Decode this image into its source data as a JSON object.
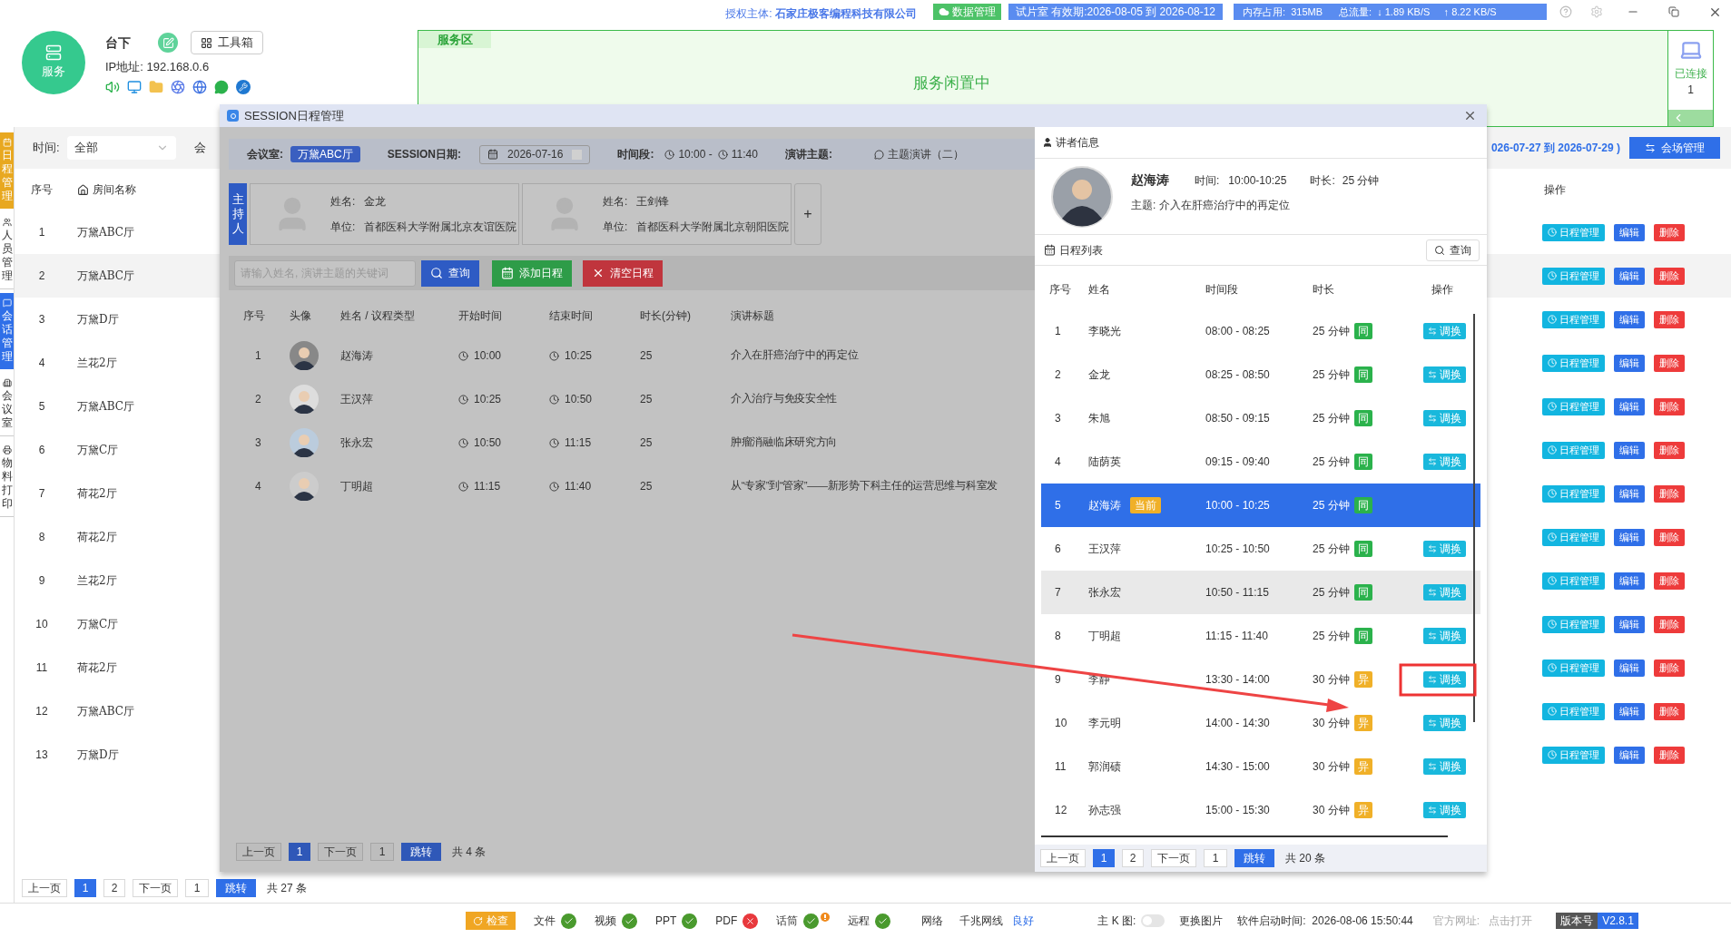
{
  "header": {
    "badge": "服务",
    "name": "台下",
    "toolbox": "工具箱",
    "ip": "IP地址: 192.168.0.6",
    "license_label": "授权主体:",
    "license": "石家庄极客编程科技有限公司",
    "data_button": "数据管理",
    "trial": "试片室  有效期:2026-08-05 到 2026-08-12",
    "memory": "内存占用:  315MB",
    "traffic": "总流量:  ↓ 1.89 KB/S     ↑ 8.22 KB/S"
  },
  "service_area": {
    "label": "服务区",
    "status": "服务闲置中",
    "connected_label": "已连接",
    "connected_count": "1"
  },
  "sidebar": {
    "tabs": [
      {
        "label": "日程管理",
        "color": "#e8a820"
      },
      {
        "label": "人员管理",
        "color": "#ffffff"
      },
      {
        "label": "会话管理",
        "color": "#2f6fe8"
      },
      {
        "label": "会议室",
        "color": "#ffffff"
      },
      {
        "label": "物料打印",
        "color": "#ffffff"
      }
    ]
  },
  "filter": {
    "label": "时间:",
    "value": "全部",
    "next_label": "会",
    "date_range": "026-07-27 到 2026-07-29 )",
    "venue_button": "会场管理"
  },
  "table": {
    "columns": [
      "序号",
      "房间名称",
      "操作"
    ],
    "rows": [
      {
        "index": "1",
        "room": "万黛ABC厅",
        "highlighted": false,
        "actions": [
          "日程管理",
          "编辑",
          "删除"
        ]
      },
      {
        "index": "2",
        "room": "万黛ABC厅",
        "highlighted": true,
        "actions": [
          "日程管理",
          "编辑",
          "删除"
        ]
      },
      {
        "index": "3",
        "room": "万黛D厅",
        "highlighted": false,
        "actions": [
          "日程管理",
          "编辑",
          "删除"
        ]
      },
      {
        "index": "4",
        "room": "兰花2厅",
        "highlighted": false,
        "actions": [
          "日程管理",
          "编辑",
          "删除"
        ]
      },
      {
        "index": "5",
        "room": "万黛ABC厅",
        "highlighted": false,
        "actions": [
          "日程管理",
          "编辑",
          "删除"
        ]
      },
      {
        "index": "6",
        "room": "万黛C厅",
        "highlighted": false,
        "actions": [
          "日程管理",
          "编辑",
          "删除"
        ]
      },
      {
        "index": "7",
        "room": "荷花2厅",
        "highlighted": false,
        "actions": [
          "日程管理",
          "编辑",
          "删除"
        ]
      },
      {
        "index": "8",
        "room": "荷花2厅",
        "highlighted": false,
        "actions": [
          "日程管理",
          "编辑",
          "删除"
        ]
      },
      {
        "index": "9",
        "room": "兰花2厅",
        "highlighted": false,
        "actions": [
          "日程管理",
          "编辑",
          "删除"
        ]
      },
      {
        "index": "10",
        "room": "万黛C厅",
        "highlighted": false,
        "actions": [
          "日程管理",
          "编辑",
          "删除"
        ]
      },
      {
        "index": "11",
        "room": "荷花2厅",
        "highlighted": false,
        "actions": [
          "日程管理",
          "编辑",
          "删除"
        ]
      },
      {
        "index": "12",
        "room": "万黛ABC厅",
        "highlighted": false,
        "actions": [
          "日程管理",
          "编辑",
          "删除"
        ]
      },
      {
        "index": "13",
        "room": "万黛D厅",
        "highlighted": false,
        "actions": [
          "日程管理",
          "编辑",
          "删除"
        ]
      }
    ]
  },
  "pagination": {
    "prev": "上一页",
    "pages": [
      {
        "label": "1",
        "selected": true
      },
      {
        "label": "2",
        "selected": false
      }
    ],
    "next": "下一页",
    "page_input": "1",
    "jump": "跳转",
    "total": "共 27 条"
  },
  "status_bar": {
    "check": "检查",
    "items": [
      {
        "label": "文件",
        "ok": true,
        "warning": false
      },
      {
        "label": "视频",
        "ok": true,
        "warning": false
      },
      {
        "label": "PPT",
        "ok": true,
        "warning": false
      },
      {
        "label": "PDF",
        "ok": false,
        "warning": false
      },
      {
        "label": "话筒",
        "ok": true,
        "warning": true
      },
      {
        "label": "远程",
        "ok": true,
        "warning": false
      }
    ],
    "network_label": "网络",
    "network_type": "千兆网线",
    "network_quality": "良好",
    "k_label": "主 K 图:",
    "k_on": false,
    "change_image": "更换图片",
    "start_time": "软件启动时间:  2026-08-06 15:50:44",
    "website_label": "官方网址:",
    "website_link": "点击打开",
    "version_label": "版本号",
    "version": "V2.8.1"
  },
  "dialog": {
    "title": "SESSION日程管理",
    "filters": {
      "room_label": "会议室:",
      "room": "万黛ABC厅",
      "date_label": "SESSION日期:",
      "date": "2026-07-16",
      "time_label": "时间段:",
      "start": "10:00 -",
      "end": "11:40",
      "topic_label": "演讲主题:",
      "topic": "主题演讲（二）"
    },
    "hosts_label": "主持人",
    "hosts": [
      {
        "name_label": "姓名:",
        "name": "金龙",
        "org_label": "单位:",
        "org": "首都医科大学附属北京友谊医院"
      },
      {
        "name_label": "姓名:",
        "name": "王剑锋",
        "org_label": "单位:",
        "org": "首都医科大学附属北京朝阳医院"
      }
    ],
    "add_host": "+",
    "search": {
      "placeholder": "请输入姓名, 演讲主题的关键词",
      "query": "查询",
      "add": "添加日程",
      "clear": "清空日程"
    },
    "table": {
      "columns": [
        "序号",
        "头像",
        "姓名 / 议程类型",
        "开始时间",
        "结束时间",
        "时长(分钟)",
        "演讲标题"
      ],
      "rows": [
        {
          "index": "1",
          "name": "赵海涛",
          "start": "10:00",
          "end": "10:25",
          "duration": "25",
          "title": "介入在肝癌治疗中的再定位"
        },
        {
          "index": "2",
          "name": "王汉萍",
          "start": "10:25",
          "end": "10:50",
          "duration": "25",
          "title": "介入治疗与免疫安全性"
        },
        {
          "index": "3",
          "name": "张永宏",
          "start": "10:50",
          "end": "11:15",
          "duration": "25",
          "title": "肿瘤消融临床研究方向"
        },
        {
          "index": "4",
          "name": "丁明超",
          "start": "11:15",
          "end": "11:40",
          "duration": "25",
          "title": "从“专家”到“管家”——新形势下科主任的运营思维与科室发"
        }
      ]
    },
    "pagination": {
      "prev": "上一页",
      "pages": [
        {
          "label": "1",
          "selected": true
        }
      ],
      "next": "下一页",
      "page_input": "1",
      "jump": "跳转",
      "total": "共 4 条"
    },
    "speaker": {
      "header": "讲者信息",
      "name": "赵海涛",
      "time_label": "时间:",
      "time": "10:00-10:25",
      "duration_label": "时长:",
      "duration": "25 分钟",
      "topic": "主题: 介入在肝癌治疗中的再定位"
    },
    "schedule": {
      "title": "日程列表",
      "query": "查询",
      "columns": [
        "序号",
        "姓名",
        "时间段",
        "时长",
        "操作"
      ],
      "rows": [
        {
          "index": "1",
          "name": "李晓光",
          "time": "08:00 - 08:25",
          "duration": "25 分钟",
          "badge": "同",
          "same": true,
          "selected": false,
          "highlighted": false,
          "action": "调换"
        },
        {
          "index": "2",
          "name": "金龙",
          "time": "08:25 - 08:50",
          "duration": "25 分钟",
          "badge": "同",
          "same": true,
          "selected": false,
          "highlighted": false,
          "action": "调换"
        },
        {
          "index": "3",
          "name": "朱旭",
          "time": "08:50 - 09:15",
          "duration": "25 分钟",
          "badge": "同",
          "same": true,
          "selected": false,
          "highlighted": false,
          "action": "调换"
        },
        {
          "index": "4",
          "name": "陆荫英",
          "time": "09:15 - 09:40",
          "duration": "25 分钟",
          "badge": "同",
          "same": true,
          "selected": false,
          "highlighted": false,
          "action": "调换"
        },
        {
          "index": "5",
          "name": "赵海涛",
          "current": "当前",
          "time": "10:00 - 10:25",
          "duration": "25 分钟",
          "badge": "同",
          "same": true,
          "selected": true,
          "highlighted": false
        },
        {
          "index": "6",
          "name": "王汉萍",
          "time": "10:25 - 10:50",
          "duration": "25 分钟",
          "badge": "同",
          "same": true,
          "selected": false,
          "highlighted": false,
          "action": "调换"
        },
        {
          "index": "7",
          "name": "张永宏",
          "time": "10:50 - 11:15",
          "duration": "25 分钟",
          "badge": "同",
          "same": true,
          "selected": false,
          "highlighted": true,
          "action": "调换"
        },
        {
          "index": "8",
          "name": "丁明超",
          "time": "11:15 - 11:40",
          "duration": "25 分钟",
          "badge": "同",
          "same": true,
          "selected": false,
          "highlighted": false,
          "action": "调换"
        },
        {
          "index": "9",
          "name": "李静",
          "time": "13:30 - 14:00",
          "duration": "30 分钟",
          "badge": "异",
          "same": false,
          "selected": false,
          "highlighted": false,
          "action": "调换"
        },
        {
          "index": "10",
          "name": "李元明",
          "time": "14:00 - 14:30",
          "duration": "30 分钟",
          "badge": "异",
          "same": false,
          "selected": false,
          "highlighted": false,
          "action": "调换"
        },
        {
          "index": "11",
          "name": "郭润碛",
          "time": "14:30 - 15:00",
          "duration": "30 分钟",
          "badge": "异",
          "same": false,
          "selected": false,
          "highlighted": false,
          "action": "调换"
        },
        {
          "index": "12",
          "name": "孙志强",
          "time": "15:00 - 15:30",
          "duration": "30 分钟",
          "badge": "异",
          "same": false,
          "selected": false,
          "highlighted": false,
          "action": "调换"
        }
      ],
      "pagination": {
        "prev": "上一页",
        "pages": [
          {
            "label": "1",
            "selected": true
          },
          {
            "label": "2",
            "selected": false
          }
        ],
        "next": "下一页",
        "page_input": "1",
        "jump": "跳转",
        "total": "共 20 条"
      }
    }
  }
}
